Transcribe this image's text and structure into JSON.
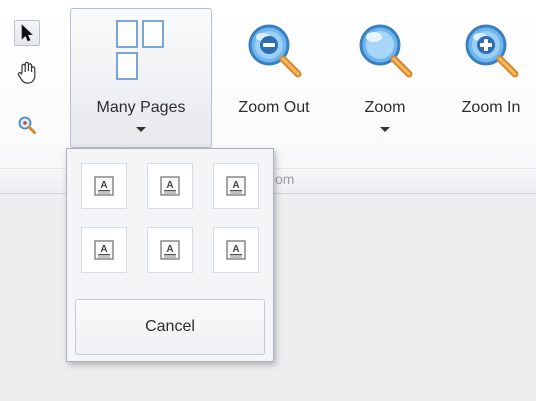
{
  "ribbon": {
    "group_caption": "Zoom",
    "group_caption_visible": "om",
    "tools": [
      {
        "name": "pointer-tool",
        "icon": "cursor-arrow-icon"
      },
      {
        "name": "hand-tool",
        "icon": "hand-pan-icon"
      },
      {
        "name": "zoom-tool",
        "icon": "magnifier-small-icon"
      }
    ],
    "buttons": {
      "many_pages": {
        "label": "Many Pages",
        "icon": "many-pages-icon"
      },
      "zoom_out": {
        "label": "Zoom Out",
        "icon": "zoom-out-magnifier-icon"
      },
      "zoom": {
        "label": "Zoom",
        "icon": "zoom-magnifier-icon"
      },
      "zoom_in": {
        "label": "Zoom In",
        "icon": "zoom-in-magnifier-icon"
      }
    }
  },
  "popup": {
    "cancel_label": "Cancel",
    "page_icon": "document-page-icon"
  },
  "colors": {
    "accent_blue": "#3b8fd6",
    "handle_orange": "#e39a3a"
  }
}
